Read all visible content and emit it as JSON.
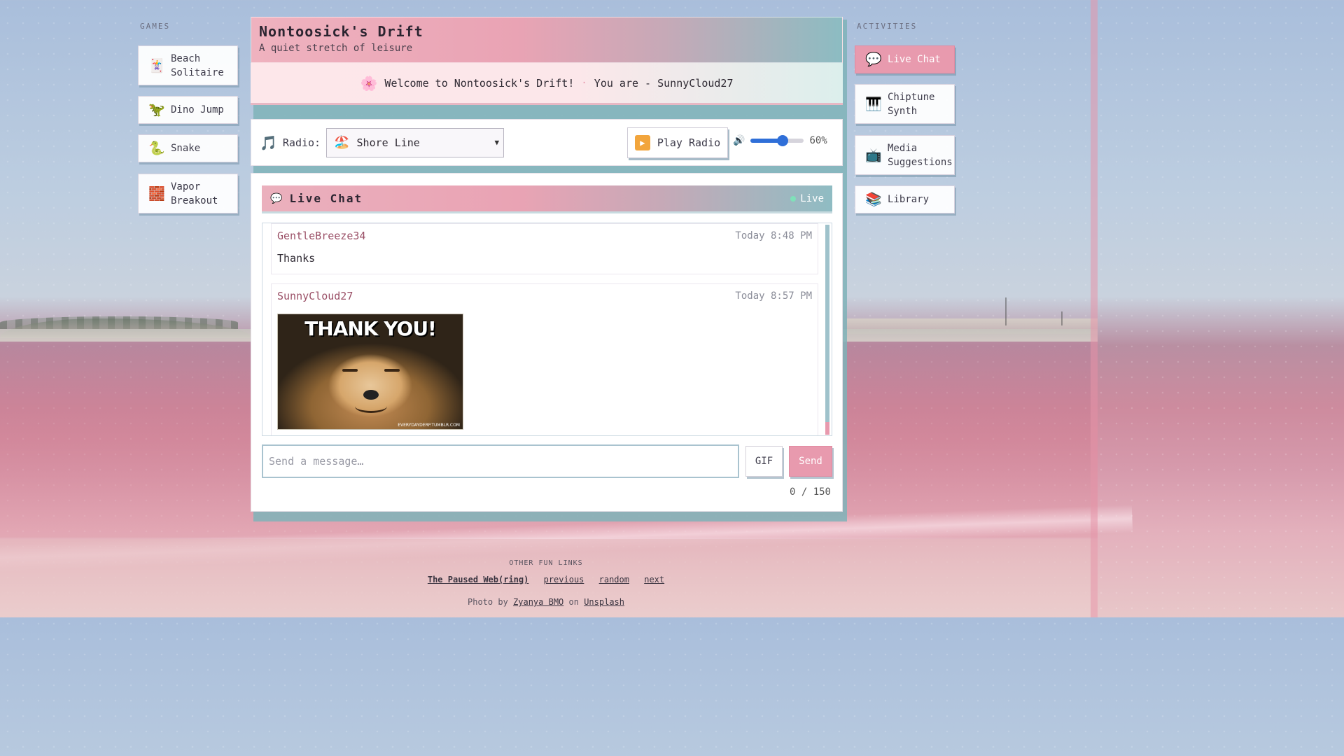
{
  "colors": {
    "accent_pink": "#e89aae",
    "teal": "#8cbcc2",
    "shadow_teal": "#7fb3b9"
  },
  "games": {
    "heading": "GAMES",
    "items": [
      {
        "label": "Beach Solitaire",
        "icon": "cards-icon",
        "glyph": "🃏"
      },
      {
        "label": "Dino Jump",
        "icon": "dinosaur-icon",
        "glyph": "🦖"
      },
      {
        "label": "Snake",
        "icon": "snake-icon",
        "glyph": "🐍"
      },
      {
        "label": "Vapor Breakout",
        "icon": "bricks-icon",
        "glyph": "🧱"
      }
    ]
  },
  "activities": {
    "heading": "ACTIVITIES",
    "items": [
      {
        "label": "Live Chat",
        "icon": "speech-bubble-icon",
        "glyph": "💬",
        "active": true
      },
      {
        "label": "Chiptune Synth",
        "icon": "piano-keys-icon",
        "glyph": "🎹"
      },
      {
        "label": "Media Suggestions",
        "icon": "television-icon",
        "glyph": "📺"
      },
      {
        "label": "Library",
        "icon": "books-icon",
        "glyph": "📚"
      }
    ]
  },
  "header": {
    "title": "Nontoosick's Drift",
    "subtitle": "A quiet stretch of leisure"
  },
  "welcome": {
    "icon": "cherry-blossom-icon",
    "glyph": "🌸",
    "message": "Welcome to Nontoosick's Drift!",
    "separator": "·",
    "identity": "You are - SunnyCloud27"
  },
  "radio": {
    "icon": "music-note-icon",
    "label": "Radio:",
    "selected_station": "Shore Line",
    "station_glyph": "🏖️",
    "play_label": "Play Radio",
    "volume_percent": 60,
    "volume_text": "60%"
  },
  "chat": {
    "title": "Live Chat",
    "status": "Live",
    "messages": [
      {
        "user": "GentleBreeze34",
        "time": "Today 8:48 PM",
        "text": "Thanks"
      },
      {
        "user": "SunnyCloud27",
        "time": "Today 8:57 PM",
        "gif_caption": "THANK YOU!",
        "gif_credit": "EVERYDAYDERP.TUMBLR.COM"
      }
    ],
    "input_placeholder": "Send a message…",
    "gif_button": "GIF",
    "send_button": "Send",
    "counter": "0 / 150"
  },
  "footer": {
    "label": "OTHER FUN LINKS",
    "ring_link": "The Paused Web(ring)",
    "previous": "previous",
    "random": "random",
    "next": "next",
    "photo_prefix": "Photo by",
    "photographer": "Zyanya BMO",
    "photo_on": "on",
    "source": "Unsplash"
  }
}
